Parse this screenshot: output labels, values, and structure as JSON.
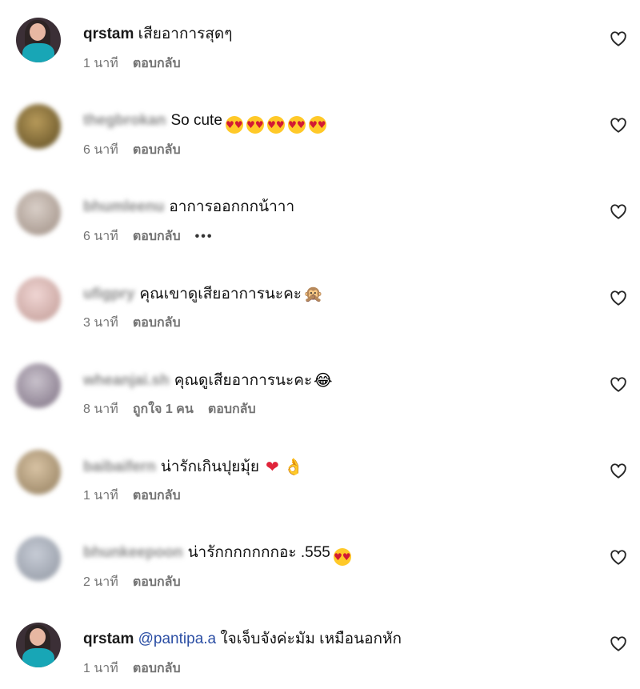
{
  "comments": [
    {
      "username": "qrstam",
      "username_blurred": false,
      "mention": "",
      "text": "เสียอาการสุดๆ",
      "emoji": "",
      "time": "1 นาที",
      "likes": "",
      "reply_label": "ตอบกลับ",
      "more": ""
    },
    {
      "username": "thegbrokan",
      "username_blurred": true,
      "mention": "",
      "text": "So cute",
      "emoji": "😍😍😍😍😍",
      "time": "6 นาที",
      "likes": "",
      "reply_label": "ตอบกลับ",
      "more": ""
    },
    {
      "username": "bhumleenu",
      "username_blurred": true,
      "mention": "",
      "text": "อาการออกกกน้าาา",
      "emoji": "",
      "time": "6 นาที",
      "likes": "",
      "reply_label": "ตอบกลับ",
      "more": "•••"
    },
    {
      "username": "ufigpry",
      "username_blurred": true,
      "mention": "",
      "text": "คุณเขาดูเสียอาการนะคะ",
      "emoji": "🙊",
      "time": "3 นาที",
      "likes": "",
      "reply_label": "ตอบกลับ",
      "more": ""
    },
    {
      "username": "wheanjai.sh",
      "username_blurred": true,
      "mention": "",
      "text": "คุณดูเสียอาการนะคะ",
      "emoji": "😂",
      "time": "8 นาที",
      "likes": "ถูกใจ 1 คน",
      "reply_label": "ตอบกลับ",
      "more": ""
    },
    {
      "username": "baibaifern",
      "username_blurred": true,
      "mention": "",
      "text": "น่ารักเกินปุยมุ้ย",
      "emoji": "❤️👌",
      "time": "1 นาที",
      "likes": "",
      "reply_label": "ตอบกลับ",
      "more": ""
    },
    {
      "username": "bhunkeepoon",
      "username_blurred": true,
      "mention": "",
      "text": "น่ารักกกกกกกอะ .555",
      "emoji": "😍",
      "time": "2 นาที",
      "likes": "",
      "reply_label": "ตอบกลับ",
      "more": ""
    },
    {
      "username": "qrstam",
      "username_blurred": false,
      "mention": "@pantipa.a",
      "text": "ใจเจ็บจังค่ะมัม เหมือนอกหัก",
      "emoji": "",
      "time": "1 นาที",
      "likes": "",
      "reply_label": "ตอบกลับ",
      "more": ""
    }
  ],
  "icons": {
    "like": "heart-outline-icon",
    "more": "more-dots-icon"
  },
  "colors": {
    "text": "#111111",
    "meta": "#737373",
    "mention": "#2b4ea4",
    "background": "#ffffff"
  }
}
